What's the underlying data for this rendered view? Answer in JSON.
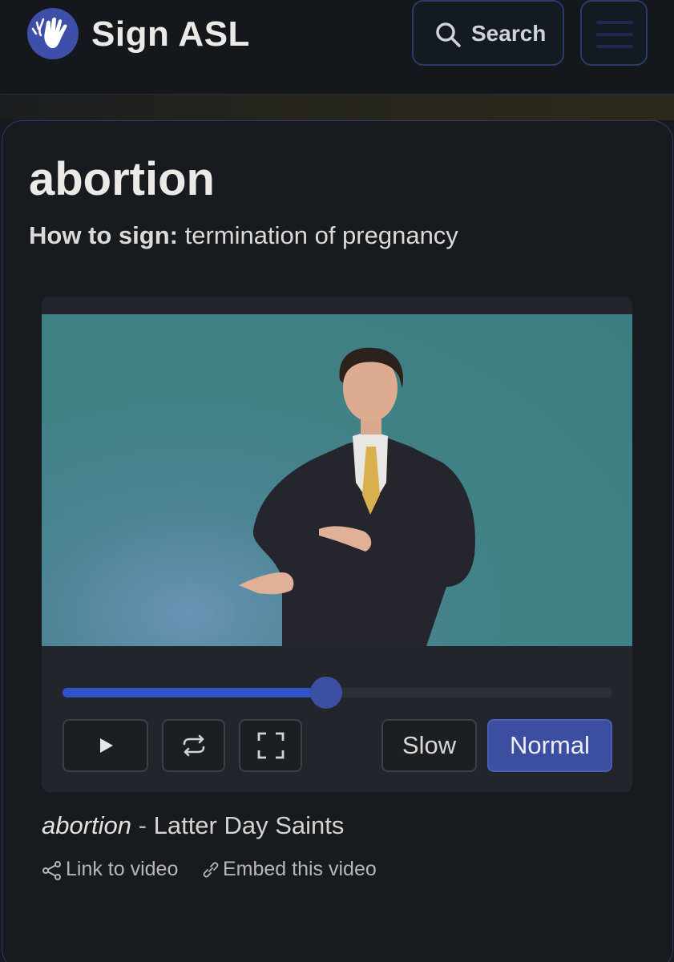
{
  "app": {
    "brand": "Sign ASL",
    "accent": "#3b4ea0"
  },
  "header": {
    "search_label": "Search",
    "menu_icon": "hamburger-icon",
    "search_icon": "search-icon"
  },
  "sign": {
    "word": "abortion",
    "how_to_sign_label": "How to sign:",
    "meaning": "termination of pregnancy"
  },
  "player": {
    "progress": 0.48,
    "speed_options": [
      "Slow",
      "Normal"
    ],
    "selected_speed": "Normal",
    "controls": [
      "play-icon",
      "loop-icon",
      "fullscreen-icon"
    ]
  },
  "caption": {
    "word": "abortion",
    "separator": " - ",
    "source": "Latter Day Saints"
  },
  "links": {
    "link_label": "Link to video",
    "embed_label": "Embed this video"
  }
}
